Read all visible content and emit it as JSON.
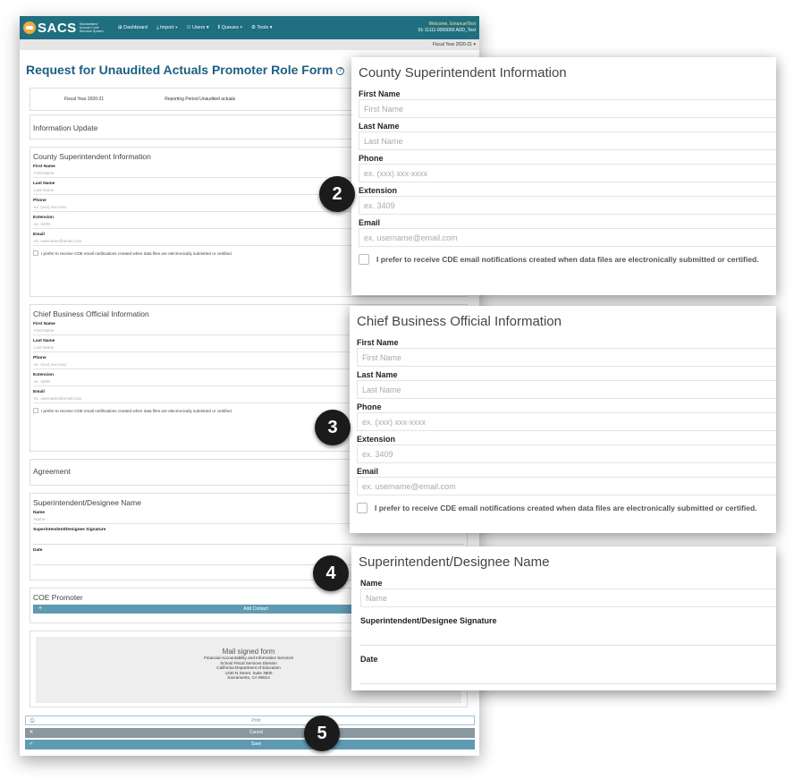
{
  "app": {
    "logo": "SACS",
    "logo_sub": "Standardized Account Code Structure System",
    "nav": [
      "Dashboard",
      "Import",
      "Users",
      "Queues",
      "Tools"
    ],
    "welcome": "Welcome, EmanuelTest",
    "org": "01-11111-0000000 ADD_Test",
    "fiscal_year_selector": "Fiscal Year 2020-21"
  },
  "page": {
    "title": "Request for Unaudited Actuals Promoter Role Form",
    "fiscal_year": "Fiscal Year 2020-21",
    "reporting_period": "Reporting Period Unaudited actuals"
  },
  "sections": {
    "info_update": "Information Update",
    "county": {
      "title": "County Superintendent Information",
      "first_name_label": "First Name",
      "first_name_ph": "First Name",
      "last_name_label": "Last Name",
      "last_name_ph": "Last Name",
      "phone_label": "Phone",
      "phone_ph": "ex. (xxx) xxx-xxxx",
      "extension_label": "Extension",
      "extension_ph": "ex. 3409",
      "email_label": "Email",
      "email_ph": "ex. username@email.com",
      "notify_label": "I prefer to receive CDE email notifications created when data files are electronically submitted or certified."
    },
    "cbo": {
      "title": "Chief Business Official Information",
      "first_name_label": "First Name",
      "first_name_ph": "First Name",
      "last_name_label": "Last Name",
      "last_name_ph": "Last Name",
      "phone_label": "Phone",
      "phone_ph": "ex. (xxx) xxx-xxxx",
      "extension_label": "Extension",
      "extension_ph": "ex. 3409",
      "email_label": "Email",
      "email_ph": "ex. username@email.com",
      "notify_label": "I prefer to receive CDE email notifications created when data files are electronically submitted or certified."
    },
    "agreement": "Agreement",
    "designee": {
      "title": "Superintendent/Designee Name",
      "name_label": "Name",
      "name_ph": "Name",
      "signature_label": "Superintendent/Designee Signature",
      "date_label": "Date"
    },
    "coe": {
      "title": "COE Promoter",
      "add_contact": "Add Contact"
    },
    "mail": {
      "title": "Mail signed form",
      "lines": [
        "Financial Accountability and Information Services",
        "School Fiscal Services Division",
        "California Department of Education",
        "1430 N Street, Suite 3800",
        "Sacramento, CA 95814"
      ]
    }
  },
  "actions": {
    "print": "Print",
    "cancel": "Cancel",
    "save": "Save"
  },
  "badges": [
    "2",
    "3",
    "4",
    "5"
  ]
}
